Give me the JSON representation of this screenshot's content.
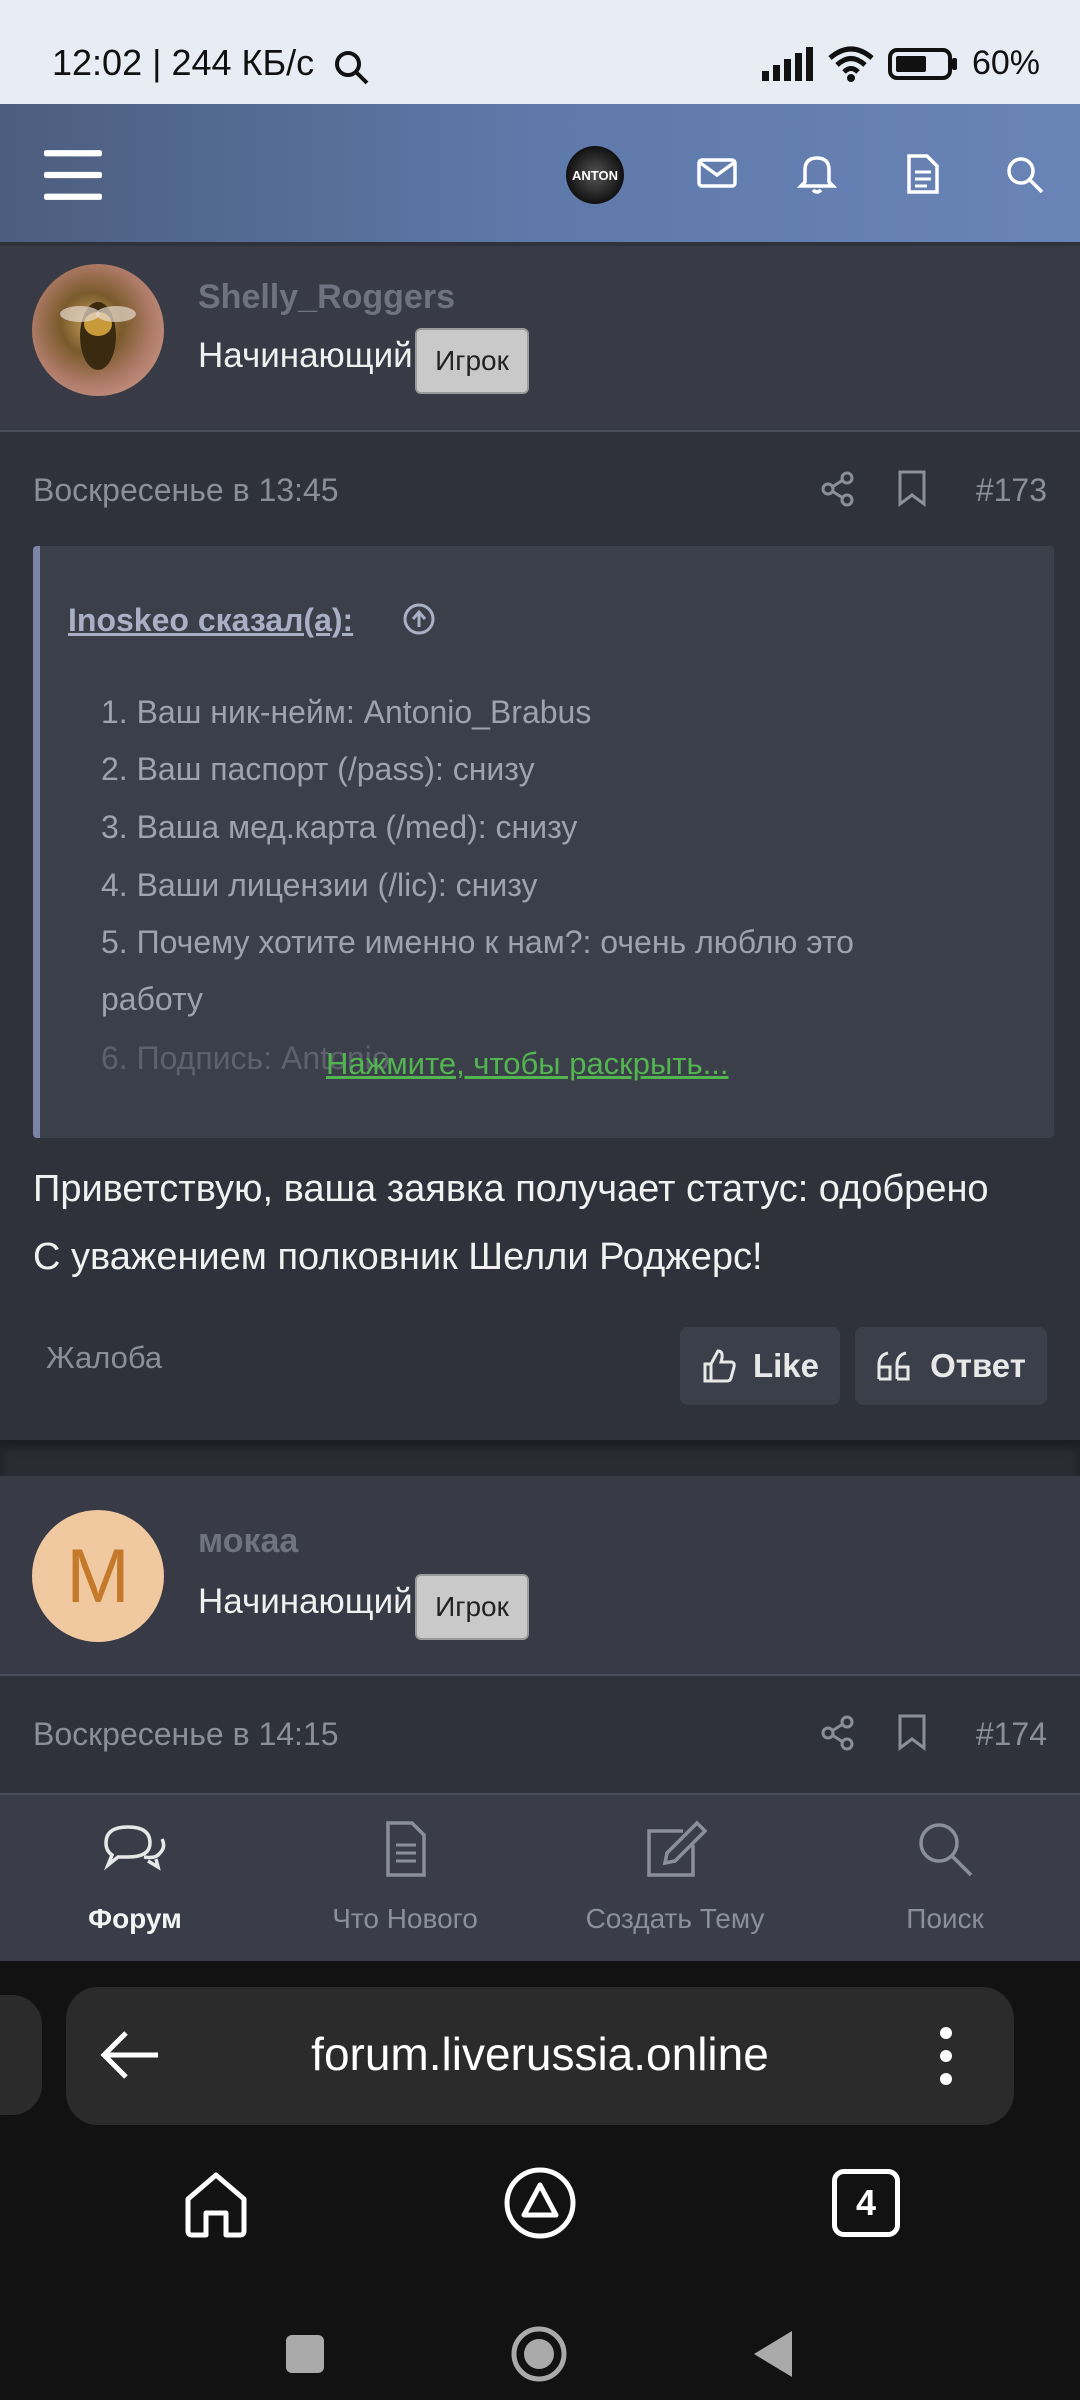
{
  "status_bar": {
    "time": "12:02 | 244 КБ/с",
    "battery": "60%"
  },
  "header": {
    "avatar_text": "ANTON",
    "icons": [
      "menu-icon",
      "avatar",
      "mail-icon",
      "bell-icon",
      "document-icon",
      "search-icon"
    ]
  },
  "posts": [
    {
      "username": "Shelly_Roggers",
      "user_title": "Начинающий",
      "badge": "Игрок",
      "date": "Воскресенье в 13:45",
      "number": "#173",
      "quote": {
        "author": "Inoskeo сказал(а):",
        "lines": [
          "1. Ваш ник-нейм: Antonio_Brabus",
          "2. Ваш паспорт (/pass): снизу",
          "3. Ваша мед.карта (/med): снизу",
          "4. Ваши лицензии (/lic): снизу",
          "5. Почему хотите именно к нам?: очень люблю это",
          "работу",
          "6. Подпись: Antonio"
        ],
        "expand": "Нажмите, чтобы раскрыть..."
      },
      "body": [
        "Приветствую, ваша заявка получает статус: одобрено",
        "С уважением полковник Шелли Роджерс!"
      ],
      "report": "Жалоба",
      "like": "Like",
      "reply": "Ответ"
    },
    {
      "username": "мокаа",
      "avatar_letter": "М",
      "user_title": "Начинающий",
      "badge": "Игрок",
      "date": "Воскресенье в 14:15",
      "number": "#174"
    }
  ],
  "bottom_nav": [
    {
      "label": "Форум",
      "icon": "chat-icon",
      "active": true
    },
    {
      "label": "Что Нового",
      "icon": "document-icon",
      "active": false
    },
    {
      "label": "Создать Тему",
      "icon": "edit-icon",
      "active": false
    },
    {
      "label": "Поиск",
      "icon": "search-icon",
      "active": false
    }
  ],
  "browser": {
    "url": "forum.liverussia.online",
    "tabs_count": "4"
  },
  "colors": {
    "accent_link": "#52b54f",
    "header_start": "#4c5e7e",
    "header_end": "#6984b6",
    "background": "#2f323b"
  }
}
